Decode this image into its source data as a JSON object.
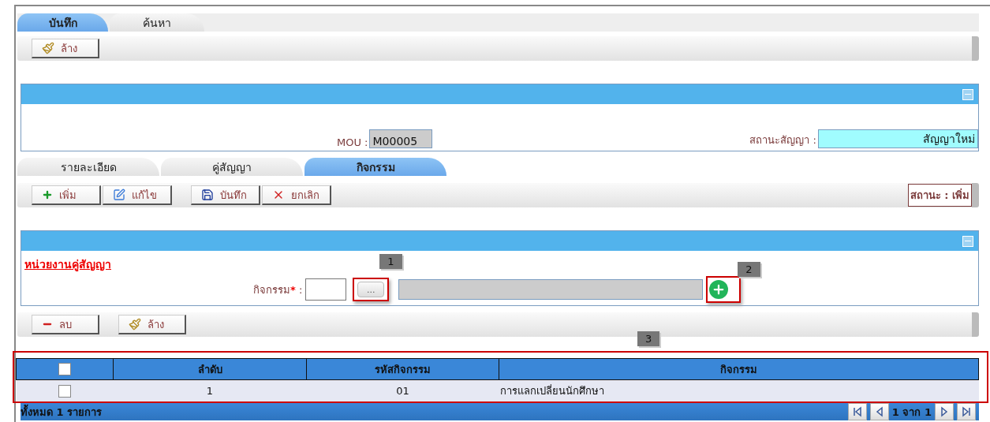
{
  "top_tabs": [
    {
      "label": "บันทึก",
      "selected": true
    },
    {
      "label": "ค้นหา",
      "selected": false
    }
  ],
  "top_toolbar": [
    {
      "kind": "clear",
      "label": "ล้าง"
    }
  ],
  "header_panel": {
    "mou_label": "MOU :",
    "mou_value": "M00005",
    "status_label": "สถานะสัญญา :",
    "status_value": "สัญญาใหม่"
  },
  "detail_tabs": [
    {
      "label": "รายละเอียด",
      "selected": false
    },
    {
      "label": "คู่สัญญา",
      "selected": false
    },
    {
      "label": "กิจกรรม",
      "selected": true
    }
  ],
  "detail_toolbar": {
    "groups": [
      [
        {
          "kind": "add",
          "label": "เพิ่ม"
        },
        {
          "kind": "edit",
          "label": "แก้ไข"
        }
      ],
      [
        {
          "kind": "save",
          "label": "บันทึก"
        },
        {
          "kind": "cancel",
          "label": "ยกเลิก"
        }
      ]
    ],
    "status": "สถานะ : เพิ่ม"
  },
  "activity_panel": {
    "section_link": "หน่วยงานคู่สัญญา",
    "field_label": "กิจกรรม",
    "required_mark": "*",
    "colon": ":",
    "browse_button": "...",
    "callout_browse": "1",
    "callout_add": "2"
  },
  "list_toolbar": [
    {
      "kind": "delete",
      "label": "ลบ"
    },
    {
      "kind": "clear",
      "label": "ล้าง"
    }
  ],
  "callout_table": "3",
  "table": {
    "header_checked": false,
    "columns": [
      "ลำดับ",
      "รหัสกิจกรรม",
      "กิจกรรม"
    ],
    "rows": [
      {
        "checked": false,
        "cells": [
          "1",
          "01",
          "การแลกเปลี่ยนนักศึกษา"
        ]
      }
    ]
  },
  "footer": {
    "total": "ทั้งหมด 1 รายการ",
    "page_info": "1 จาก 1"
  }
}
